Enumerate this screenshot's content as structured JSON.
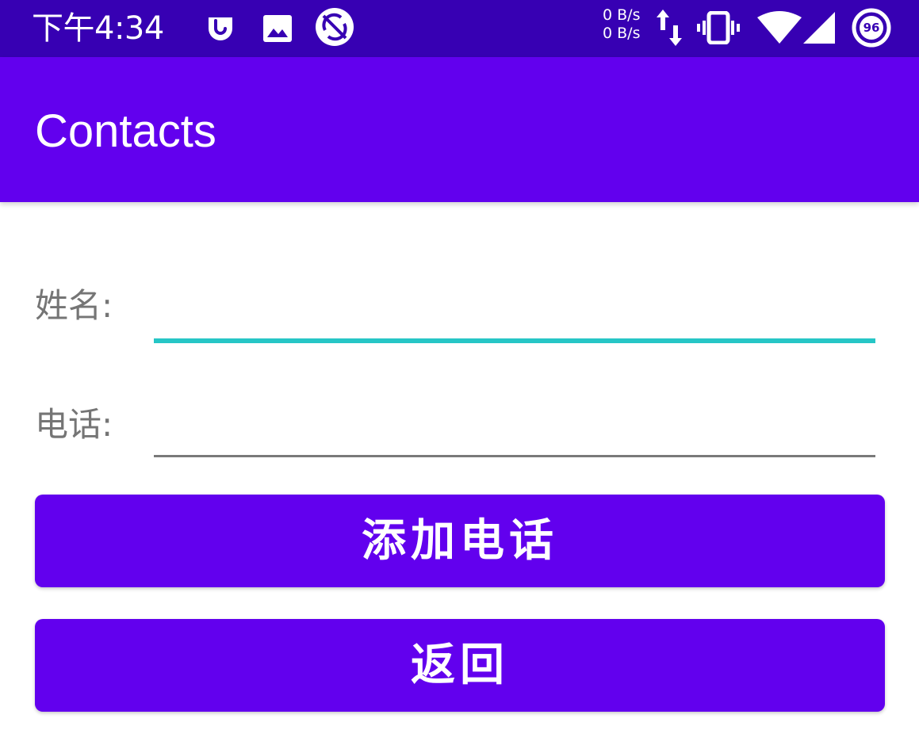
{
  "status_bar": {
    "time": "下午4:34",
    "net_up": "0 B/s",
    "net_down": "0 B/s",
    "battery": "96",
    "icons": [
      "notification-app-icon",
      "gallery-icon",
      "sync-icon",
      "data-transfer-icon",
      "vibrate-icon",
      "wifi-icon",
      "signal-icon",
      "battery-icon"
    ]
  },
  "app_bar": {
    "title": "Contacts"
  },
  "form": {
    "name_label": "姓名:",
    "name_value": "",
    "phone_label": "电话:",
    "phone_value": ""
  },
  "buttons": {
    "add": "添加电话",
    "back": "返回"
  },
  "colors": {
    "status_bar": "#3700b3",
    "primary": "#6200ee",
    "accent": "#26c6c6",
    "label": "#757575"
  }
}
